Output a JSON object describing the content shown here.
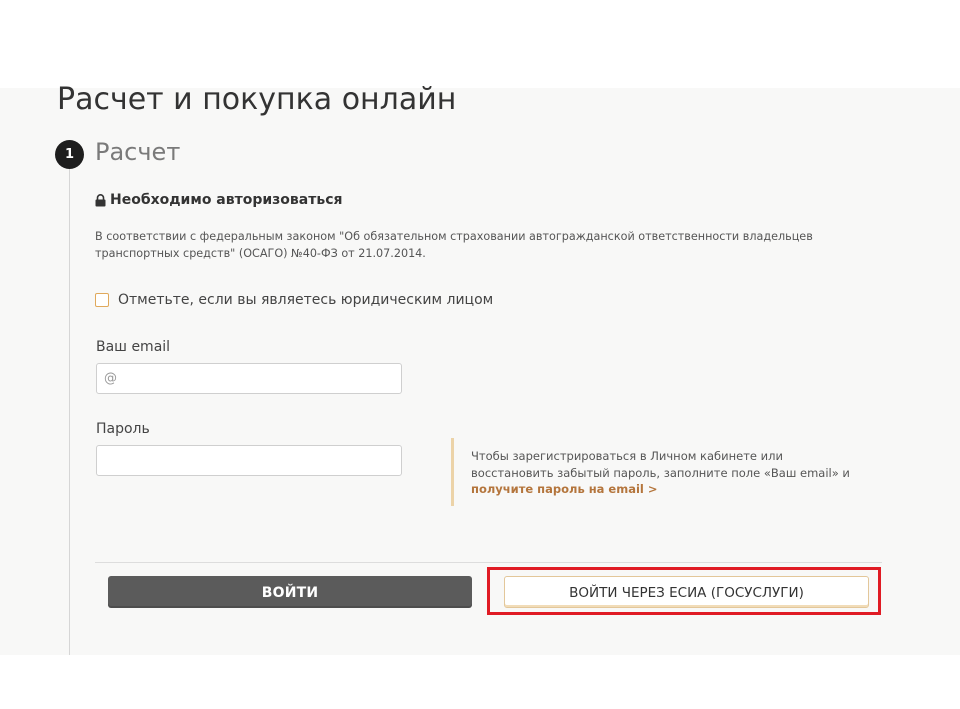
{
  "page": {
    "title": "Расчет и покупка онлайн"
  },
  "step": {
    "number": "1",
    "title": "Расчет"
  },
  "auth": {
    "heading": "Необходимо авторизоваться",
    "law_text": "В соответствии с федеральным законом \"Об обязательном страховании автогражданской ответственности владельцев транспортных средств\" (ОСАГО) №40-ФЗ от 21.07.2014.",
    "legal_entity_checkbox_label": "Отметьте, если вы являетесь юридическим лицом",
    "legal_entity_checked": false
  },
  "form": {
    "email_label": "Ваш email",
    "email_placeholder": "@",
    "email_value": "",
    "password_label": "Пароль",
    "password_value": ""
  },
  "hint": {
    "text": "Чтобы зарегистрироваться в Личном кабинете или восстановить забытый пароль, заполните поле «Ваш email» и",
    "link": "получите пароль на email >"
  },
  "buttons": {
    "login": "ВОЙТИ",
    "esia_login": "ВОЙТИ ЧЕРЕЗ ЕСИА (ГОСУСЛУГИ)"
  },
  "colors": {
    "accent": "#e0a95c",
    "link": "#b4753c",
    "highlight": "#e01b24",
    "primary_button": "#5b5b5b"
  }
}
